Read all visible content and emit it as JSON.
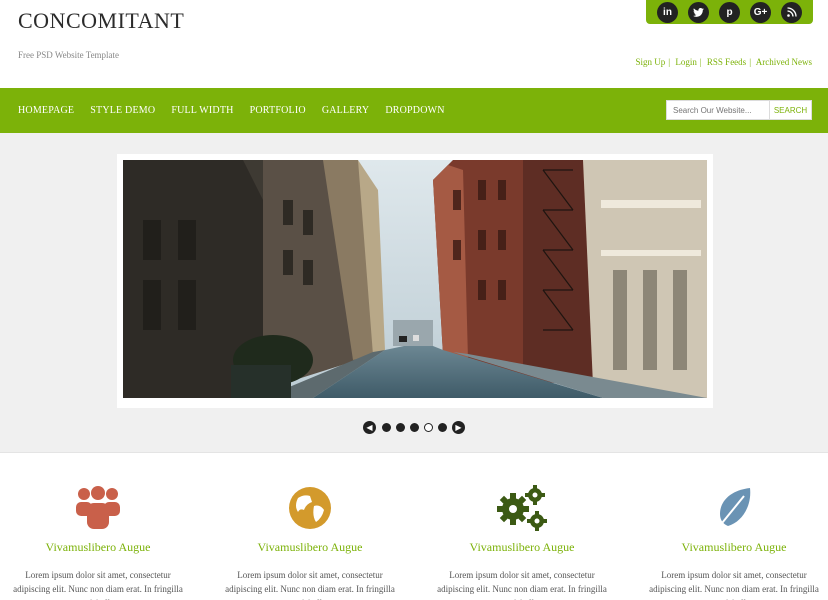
{
  "site": {
    "title": "CONCOMITANT",
    "tagline": "Free PSD Website Template"
  },
  "social": [
    {
      "icon": "linkedin-icon",
      "glyph": "in"
    },
    {
      "icon": "twitter-icon",
      "glyph": "t"
    },
    {
      "icon": "pinterest-icon",
      "glyph": "p"
    },
    {
      "icon": "google-plus-icon",
      "glyph": "G+"
    },
    {
      "icon": "rss-icon",
      "glyph": "))"
    }
  ],
  "toplinks": {
    "signup": "Sign Up",
    "login": "Login",
    "rss": "RSS Feeds",
    "archived": "Archived News"
  },
  "nav": {
    "items": [
      "HOMEPAGE",
      "STYLE DEMO",
      "FULL WIDTH",
      "PORTFOLIO",
      "GALLERY",
      "DROPDOWN"
    ]
  },
  "search": {
    "placeholder": "Search Our Website...",
    "button": "SEARCH"
  },
  "slider": {
    "image": "city-street-photo",
    "total_slides": 5,
    "active_slide": 4
  },
  "features": [
    {
      "icon": "people-icon",
      "color": "#c9604a",
      "title": "Vivamuslibero Augue",
      "text": "Lorem ipsum dolor sit amet, consectetur adipiscing elit. Nunc non diam erat. In fringilla massa ut nisi ullamcorper"
    },
    {
      "icon": "globe-icon",
      "color": "#d39a2c",
      "title": "Vivamuslibero Augue",
      "text": "Lorem ipsum dolor sit amet, consectetur adipiscing elit. Nunc non diam erat. In fringilla massa ut nisi ullamcorper"
    },
    {
      "icon": "gears-icon",
      "color": "#3c5a14",
      "title": "Vivamuslibero Augue",
      "text": "Lorem ipsum dolor sit amet, consectetur adipiscing elit. Nunc non diam erat. In fringilla massa ut nisi ullamcorper"
    },
    {
      "icon": "leaf-icon",
      "color": "#6a93b4",
      "title": "Vivamuslibero Augue",
      "text": "Lorem ipsum dolor sit amet, consectetur adipiscing elit. Nunc non diam erat. In fringilla massa ut nisi ullamcorper"
    }
  ],
  "colors": {
    "accent": "#7cb209",
    "band": "#f0f0f0"
  }
}
